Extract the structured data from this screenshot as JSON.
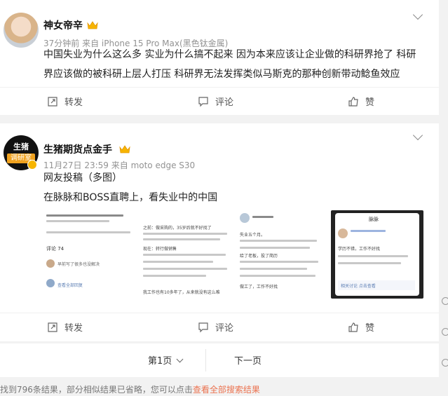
{
  "posts": [
    {
      "author": "神女帝辛",
      "meta": "37分钟前   来自 iPhone 15 Pro Max(黑色钛金属)",
      "lines": [
        "中国失业为什么这么多 实业为什么搞不起来 因为本来应该让企业做的科研界抢了 科研",
        "界应该做的被科研上层人打压 科研界无法发挥类似马斯克的那种创新带动鲶鱼效应"
      ],
      "repost": "转发",
      "comment": "评论",
      "like": "赞"
    },
    {
      "author": "生猪期货点金手",
      "avatar_line1": "生猪",
      "avatar_line2": "调研室",
      "meta": "11月27日 23:59   来自 moto edge S30",
      "lines": [
        "网友投稿（多图）",
        "在脉脉和BOSS直聘上，看失业中的中国"
      ],
      "repost": "转发",
      "comment": "评论",
      "like": "赞",
      "thumbs": [
        {
          "t1": "评论 74",
          "t2": "早前写了很多也没解决",
          "t3": "查看全部回复"
        },
        {
          "t1": "之前：做采购的，35岁后就不好找了",
          "t2": "现在：转行做销售",
          "t3": "我工作也有10多年了，从来就没有这么难"
        },
        {
          "t1": "失业五个月。",
          "t2": "给了老板，投了简历",
          "t3": "做工了，工作不好找"
        },
        {
          "t1": "脉脉",
          "t2": "学历不错，工作不好找",
          "t3": "相关讨论 点击查看"
        }
      ]
    }
  ],
  "pager": {
    "page": "第1页",
    "next": "下一页"
  },
  "footer": {
    "prefix": "找到796条结果，部分相似结果已省略，您可以点击",
    "link": "查看全部搜索结果"
  },
  "colors": {
    "accent": "#eb7350",
    "meta": "#939393",
    "gold": "#f7b500"
  }
}
